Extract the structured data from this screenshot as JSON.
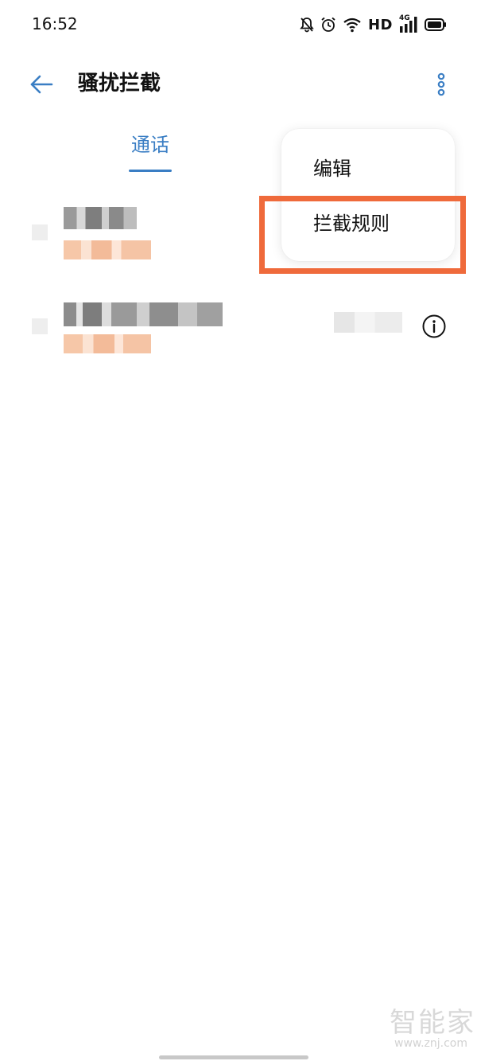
{
  "status_bar": {
    "time": "16:52",
    "network_label": "HD",
    "signal_label": "4G",
    "icons": [
      "bell-muted-icon",
      "alarm-icon",
      "wifi-icon",
      "signal-icon",
      "battery-icon"
    ]
  },
  "app_bar": {
    "title": "骚扰拦截",
    "back_icon": "arrow-left-icon",
    "more_icon": "more-vertical-icon"
  },
  "tabs": [
    {
      "label": "通话",
      "active": true
    }
  ],
  "menu": {
    "items": [
      {
        "label": "编辑"
      },
      {
        "label": "拦截规则"
      }
    ],
    "highlighted_index": 1
  },
  "watermark": {
    "logo": "智能家",
    "url": "www.znj.com"
  },
  "colors": {
    "accent": "#3a7ec4",
    "highlight": "#ef6a3b"
  }
}
